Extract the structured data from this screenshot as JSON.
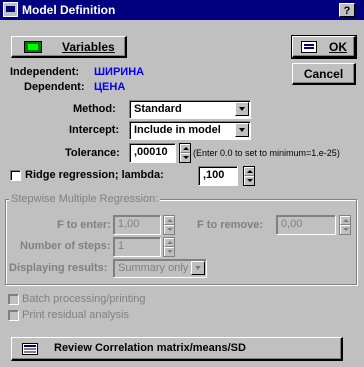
{
  "window": {
    "title": "Model Definition",
    "help_label": "?"
  },
  "buttons": {
    "variables_label": "Variables",
    "ok_label": "OK",
    "cancel_label": "Cancel",
    "review_label": "Review Correlation matrix/means/SD"
  },
  "variables": {
    "independent_label": "Independent:",
    "independent_value": "ШИРИНА",
    "dependent_label": "Dependent:",
    "dependent_value": "ЦЕНА"
  },
  "method": {
    "label": "Method:",
    "value": "Standard"
  },
  "intercept": {
    "label": "Intercept:",
    "value": "Include in model"
  },
  "tolerance": {
    "label": "Tolerance:",
    "value": ",00010",
    "hint": "(Enter 0.0 to set to minimum=1.e-25)"
  },
  "ridge": {
    "label": "Ridge regression; lambda:",
    "value": ",100",
    "checked": false
  },
  "stepwise": {
    "group_title": "Stepwise Multiple Regression:",
    "f_enter_label": "F to enter:",
    "f_enter_value": "1,00",
    "f_remove_label": "F to remove:",
    "f_remove_value": "0,00",
    "steps_label": "Number of steps:",
    "steps_value": "1",
    "display_label": "Displaying results:",
    "display_value": "Summary only"
  },
  "options": {
    "batch_label": "Batch processing/printing",
    "residual_label": "Print residual analysis"
  },
  "colors": {
    "title_bg": "#000080",
    "face": "#c0c0c0",
    "variable_text": "#0000ff",
    "disabled_text": "#808080"
  }
}
